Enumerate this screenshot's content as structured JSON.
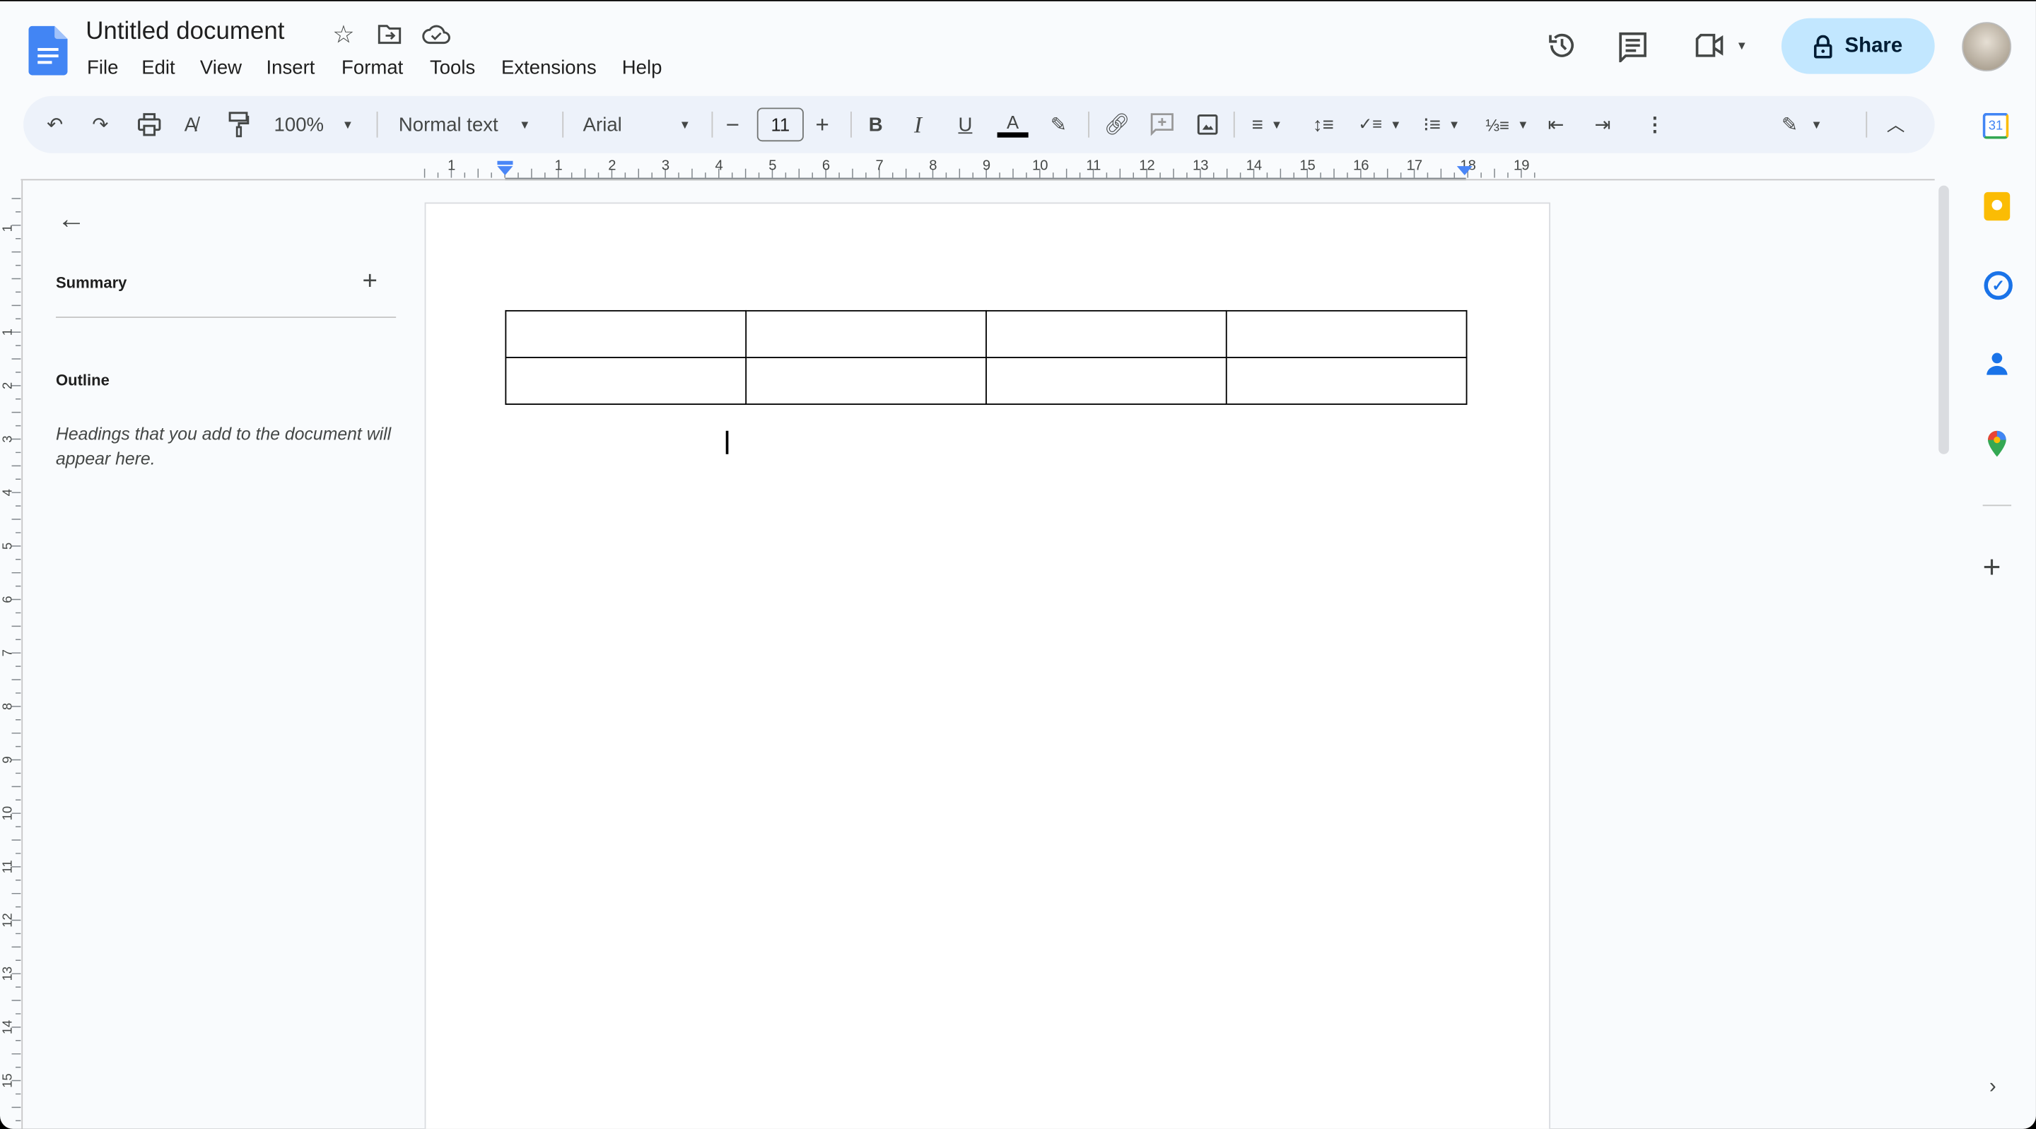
{
  "header": {
    "title": "Untitled document",
    "menus": [
      "File",
      "Edit",
      "View",
      "Insert",
      "Format",
      "Tools",
      "Extensions",
      "Help"
    ],
    "share_label": "Share"
  },
  "toolbar": {
    "zoom": "100%",
    "style": "Normal text",
    "font": "Arial",
    "font_size": "11"
  },
  "ruler": {
    "horizontal": [
      "1",
      "1",
      "2",
      "3",
      "4",
      "5",
      "6",
      "7",
      "8",
      "9",
      "10",
      "11",
      "12",
      "13",
      "14",
      "15",
      "16",
      "17",
      "18",
      "19"
    ],
    "vertical": [
      "1",
      "1",
      "2",
      "3",
      "4",
      "5",
      "6",
      "7",
      "8",
      "9",
      "10",
      "11",
      "12",
      "13",
      "14",
      "15"
    ]
  },
  "outline_panel": {
    "summary_label": "Summary",
    "outline_label": "Outline",
    "placeholder": "Headings that you add to the document will appear here."
  },
  "document": {
    "table": {
      "rows": 2,
      "cols": 4,
      "cells": [
        [
          "",
          "",
          "",
          ""
        ],
        [
          "",
          "",
          "",
          ""
        ]
      ]
    }
  },
  "side_panel": {
    "calendar_day": "31"
  },
  "colors": {
    "accent": "#0b57d0",
    "share_bg": "#c2e7ff",
    "toolbar_bg": "#edf2fa",
    "docs_blue": "#4285f4"
  }
}
